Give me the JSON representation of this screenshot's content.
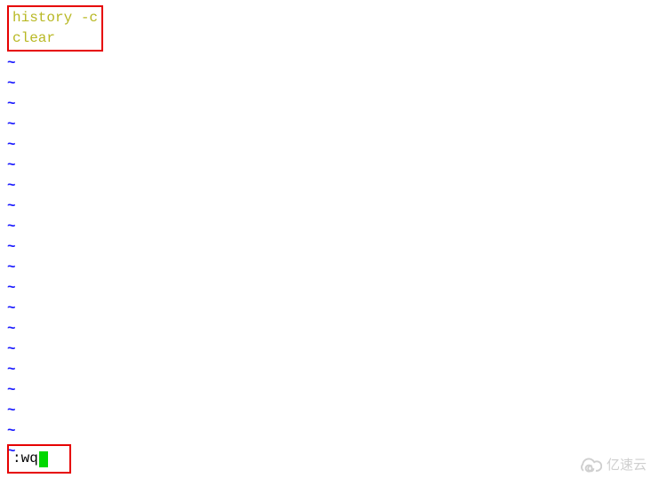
{
  "editor": {
    "content_lines": [
      "history -c",
      "clear"
    ],
    "tilde_count": 20,
    "tilde_char": "~"
  },
  "command_line": {
    "text": ":wq"
  },
  "watermark": {
    "text": "亿速云"
  }
}
